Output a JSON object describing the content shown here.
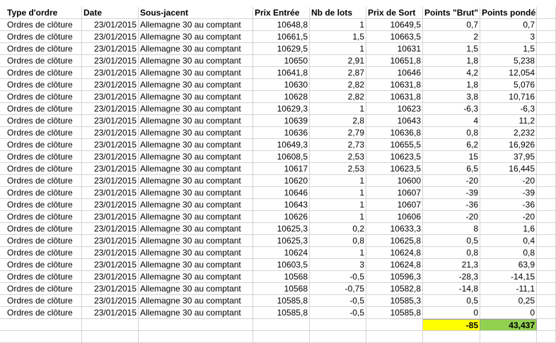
{
  "headers": [
    "Type d'ordre",
    "Date",
    "Sous-jacent",
    "Prix Entrée",
    "Nb de lots",
    "Prix de Sort",
    "Points \"Brut\"",
    "Points pondéré"
  ],
  "rows": [
    [
      "Ordres de clôture",
      "23/01/2015",
      "Allemagne 30 au comptant",
      "10648,8",
      "1",
      "10649,5",
      "0,7",
      "0,7"
    ],
    [
      "Ordres de clôture",
      "23/01/2015",
      "Allemagne 30 au comptant",
      "10661,5",
      "1,5",
      "10663,5",
      "2",
      "3"
    ],
    [
      "Ordres de clôture",
      "23/01/2015",
      "Allemagne 30 au comptant",
      "10629,5",
      "1",
      "10631",
      "1,5",
      "1,5"
    ],
    [
      "Ordres de clôture",
      "23/01/2015",
      "Allemagne 30 au comptant",
      "10650",
      "2,91",
      "10651,8",
      "1,8",
      "5,238"
    ],
    [
      "Ordres de clôture",
      "23/01/2015",
      "Allemagne 30 au comptant",
      "10641,8",
      "2,87",
      "10646",
      "4,2",
      "12,054"
    ],
    [
      "Ordres de clôture",
      "23/01/2015",
      "Allemagne 30 au comptant",
      "10630",
      "2,82",
      "10631,8",
      "1,8",
      "5,076"
    ],
    [
      "Ordres de clôture",
      "23/01/2015",
      "Allemagne 30 au comptant",
      "10628",
      "2,82",
      "10631,8",
      "3,8",
      "10,716"
    ],
    [
      "Ordres de clôture",
      "23/01/2015",
      "Allemagne 30 au comptant",
      "10629,3",
      "1",
      "10623",
      "-6,3",
      "-6,3"
    ],
    [
      "Ordres de clôture",
      "23/01/2015",
      "Allemagne 30 au comptant",
      "10639",
      "2,8",
      "10643",
      "4",
      "11,2"
    ],
    [
      "Ordres de clôture",
      "23/01/2015",
      "Allemagne 30 au comptant",
      "10636",
      "2,79",
      "10636,8",
      "0,8",
      "2,232"
    ],
    [
      "Ordres de clôture",
      "23/01/2015",
      "Allemagne 30 au comptant",
      "10649,3",
      "2,73",
      "10655,5",
      "6,2",
      "16,926"
    ],
    [
      "Ordres de clôture",
      "23/01/2015",
      "Allemagne 30 au comptant",
      "10608,5",
      "2,53",
      "10623,5",
      "15",
      "37,95"
    ],
    [
      "Ordres de clôture",
      "23/01/2015",
      "Allemagne 30 au comptant",
      "10617",
      "2,53",
      "10623,5",
      "6,5",
      "16,445"
    ],
    [
      "Ordres de clôture",
      "23/01/2015",
      "Allemagne 30 au comptant",
      "10620",
      "1",
      "10600",
      "-20",
      "-20"
    ],
    [
      "Ordres de clôture",
      "23/01/2015",
      "Allemagne 30 au comptant",
      "10646",
      "1",
      "10607",
      "-39",
      "-39"
    ],
    [
      "Ordres de clôture",
      "23/01/2015",
      "Allemagne 30 au comptant",
      "10643",
      "1",
      "10607",
      "-36",
      "-36"
    ],
    [
      "Ordres de clôture",
      "23/01/2015",
      "Allemagne 30 au comptant",
      "10626",
      "1",
      "10606",
      "-20",
      "-20"
    ],
    [
      "Ordres de clôture",
      "23/01/2015",
      "Allemagne 30 au comptant",
      "10625,3",
      "0,2",
      "10633,3",
      "8",
      "1,6"
    ],
    [
      "Ordres de clôture",
      "23/01/2015",
      "Allemagne 30 au comptant",
      "10625,3",
      "0,8",
      "10625,8",
      "0,5",
      "0,4"
    ],
    [
      "Ordres de clôture",
      "23/01/2015",
      "Allemagne 30 au comptant",
      "10624",
      "1",
      "10624,8",
      "0,8",
      "0,8"
    ],
    [
      "Ordres de clôture",
      "23/01/2015",
      "Allemagne 30 au comptant",
      "10603,5",
      "3",
      "10624,8",
      "21,3",
      "63,9"
    ],
    [
      "Ordres de clôture",
      "23/01/2015",
      "Allemagne 30 au comptant",
      "10568",
      "-0,5",
      "10596,3",
      "-28,3",
      "-14,15"
    ],
    [
      "Ordres de clôture",
      "23/01/2015",
      "Allemagne 30 au comptant",
      "10568",
      "-0,75",
      "10582,8",
      "-14,8",
      "-11,1"
    ],
    [
      "Ordres de clôture",
      "23/01/2015",
      "Allemagne 30 au comptant",
      "10585,8",
      "-0,5",
      "10585,3",
      "0,5",
      "0,25"
    ],
    [
      "Ordres de clôture",
      "23/01/2015",
      "Allemagne 30 au comptant",
      "10585,8",
      "-0,5",
      "10585,8",
      "0",
      "0"
    ]
  ],
  "totals": {
    "points_brut": "-85",
    "points_pondere": "43,437"
  },
  "colors": {
    "total_brut_fill": "#ffff00",
    "total_pondere_fill": "#92d050",
    "gridline": "#d4d4d4"
  }
}
